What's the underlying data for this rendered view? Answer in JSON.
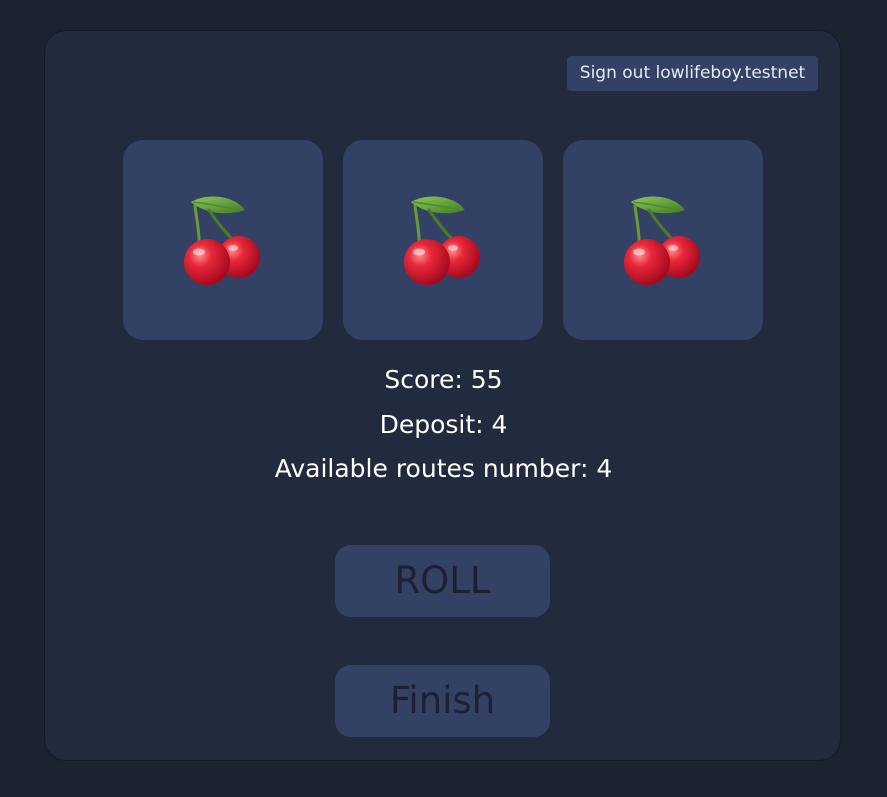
{
  "header": {
    "signout_label": "Sign out lowlifeboy.testnet"
  },
  "reels": [
    {
      "symbol": "cherry-icon"
    },
    {
      "symbol": "cherry-icon"
    },
    {
      "symbol": "cherry-icon"
    }
  ],
  "stats": {
    "score": "Score: 55",
    "deposit": "Deposit: 4",
    "routes": "Available routes number: 4"
  },
  "actions": {
    "roll_label": "ROLL",
    "finish_label": "Finish"
  },
  "colors": {
    "page_background": "#1b2230",
    "panel_background": "#222a3e",
    "tile_background": "#334264",
    "text": "#ffffff",
    "button_text": "#1b2130"
  }
}
